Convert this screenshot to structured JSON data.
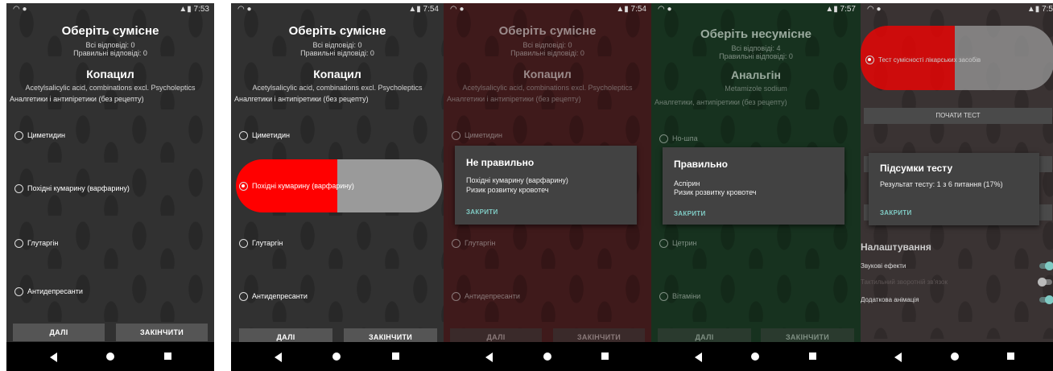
{
  "status": {
    "times": [
      "7:53",
      "7:54",
      "7:54",
      "7:57",
      "7:5"
    ],
    "icons": [
      "wifi-icon",
      "signal-icon",
      "battery-icon"
    ]
  },
  "quiz": {
    "title_compatible": "Оберіть сумісне",
    "title_incompatible": "Оберіть несумісне",
    "all_answers": "Всі відповіді: 0",
    "all_answers_4": "Всі відповіді: 4",
    "correct_answers": "Правильні відповіді: 0",
    "drug_1": "Копацил",
    "substance_1": "Acetylsalicylic acid, combinations excl. Psycholeptics",
    "category_1": "Аналгетики і антипіретики (без рецепту)",
    "drug_2": "Анальгін",
    "substance_2": "Metamizole sodium",
    "category_2": "Аналгетики, антипіретики (без рецепту)",
    "options_1": [
      "Циметидин",
      "Похідні кумарину (варфарину)",
      "Глутаргін",
      "Антидепресанти"
    ],
    "options_2": [
      "Но-шпа",
      "Аспірин",
      "Цетрин",
      "Вітаміни"
    ],
    "next": "ДАЛІ",
    "finish": "ЗАКІНЧИТИ"
  },
  "dialogs": {
    "wrong": {
      "title": "Не правильно",
      "line1": "Похідні кумарину (варфарину)",
      "line2": "Ризик розвитку кровотеч",
      "close": "ЗАКРИТИ"
    },
    "right": {
      "title": "Правильно",
      "line1": "Аспірин",
      "line2": "Ризик розвитку кровотеч",
      "close": "ЗАКРИТИ"
    },
    "summary": {
      "title": "Підсумки тесту",
      "line1": "Результат тесту: 1 з 6 питання (17%)",
      "close": "ЗАКРИТИ"
    }
  },
  "menu": {
    "test_option": "Тест сумісності лікарських засобів",
    "start": "ПОЧАТИ ТЕСТ",
    "settings": "Налаштування",
    "sound": "Звукові ефекти",
    "tactile": "Тактильний зворотній зв'язок",
    "animation": "Додаткова анімація",
    "toggles": {
      "sound": true,
      "tactile": false,
      "animation": true
    }
  },
  "colors": {
    "accent": "#80cbc4",
    "pill_red": "#ff0000",
    "pill_gray": "#9a9a9a"
  }
}
